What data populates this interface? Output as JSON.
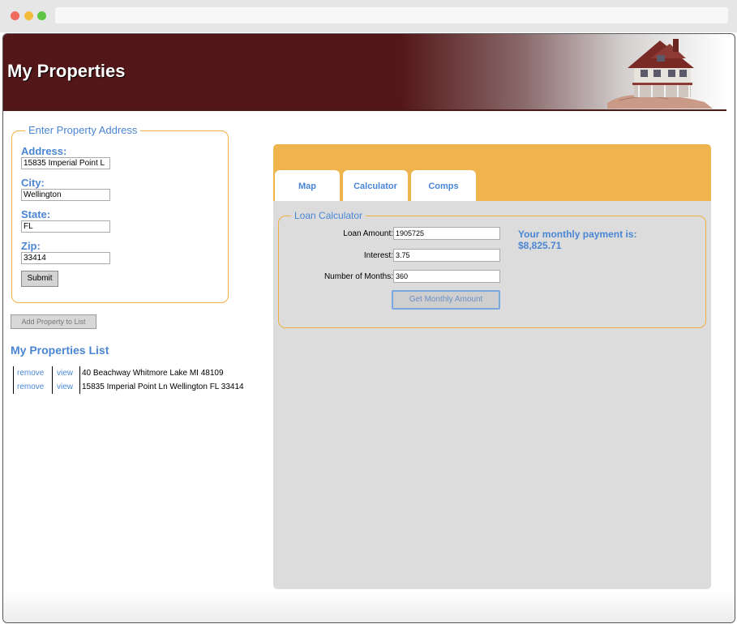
{
  "header": {
    "title": "My Properties"
  },
  "address_form": {
    "legend": "Enter Property Address",
    "address_label": "Address:",
    "address_value": "15835 Imperial Point L",
    "city_label": "City:",
    "city_value": "Wellington",
    "state_label": "State:",
    "state_value": "FL",
    "zip_label": "Zip:",
    "zip_value": "33414",
    "submit_label": "Submit"
  },
  "add_property_label": "Add Property to List",
  "properties_list": {
    "title": "My Properties List",
    "rows": [
      {
        "remove": "remove",
        "view": "view",
        "address": "40 Beachway Whitmore Lake MI 48109"
      },
      {
        "remove": "remove",
        "view": "view",
        "address": "15835 Imperial Point Ln Wellington FL 33414"
      }
    ]
  },
  "tabs": [
    {
      "label": "Map"
    },
    {
      "label": "Calculator"
    },
    {
      "label": "Comps"
    }
  ],
  "calculator": {
    "legend": "Loan Calculator",
    "loan_amount_label": "Loan Amount:",
    "loan_amount_value": "1905725",
    "interest_label": "Interest:",
    "interest_value": "3.75",
    "months_label": "Number of Months:",
    "months_value": "360",
    "button_label": "Get Monthly Amount",
    "result_label": "Your monthly payment is:",
    "result_value": "$8,825.71"
  },
  "colors": {
    "banner": "#541719",
    "accent_blue": "#4a86d4",
    "panel_orange": "#f0b44f",
    "panel_gray": "#dcdcdc"
  },
  "icons": [
    "house-hand-image"
  ]
}
